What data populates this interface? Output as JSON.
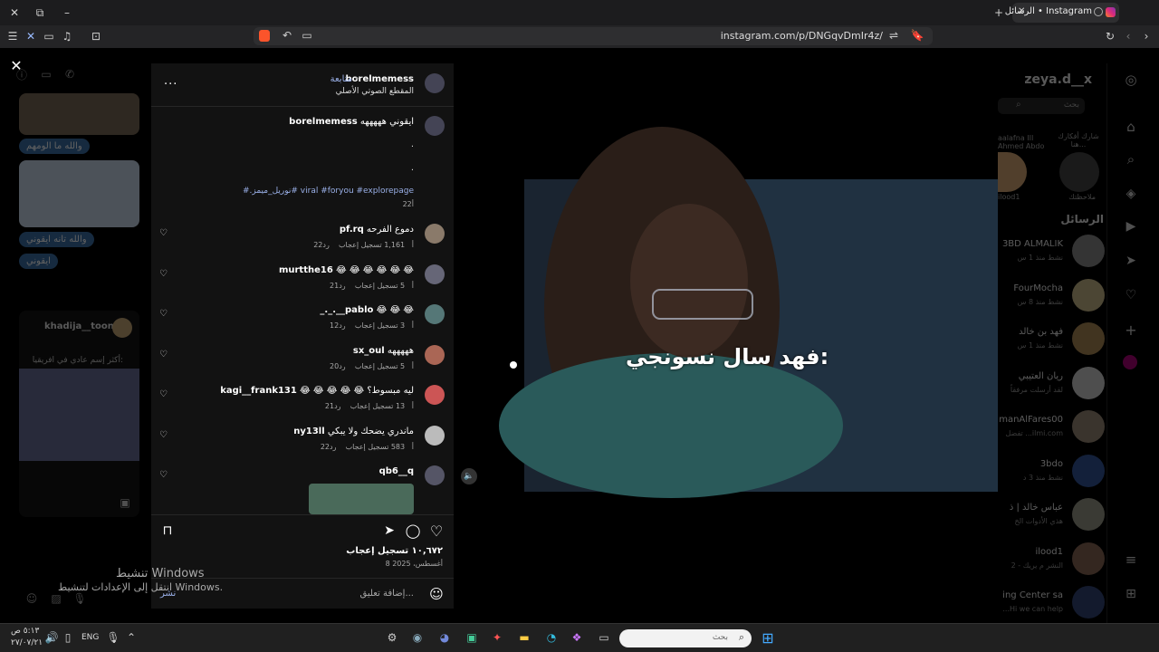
{
  "browser": {
    "tab_title": "الرسائل • Instagram",
    "tab_close": "✕",
    "new_tab": "+",
    "url": "instagram.com/p/DNGqvDmIr4z/",
    "window_controls": {
      "close": "✕",
      "restore": "⧉",
      "minimize": "–"
    }
  },
  "dm_bg": {
    "bubbles": [
      "والله ما الومهم",
      "والله تانه ايقوني",
      "ايقوني"
    ],
    "shared_user": "khadija__toon",
    "shared_caption": "أكثر إسم عادي في افريقيا:"
  },
  "post": {
    "author": "borelmemess",
    "follow": "متابعة",
    "dot": "•",
    "audio": "المقطع الصوتي الأصلي",
    "caption_user": "borelmemess",
    "caption_text": "ايقوني هههههه",
    "caption_dot1": ".",
    "caption_dot2": ".",
    "hashtags": "#.نوريل_ميمز# viral #foryou #explorepage",
    "caption_age": "22أ",
    "likes": "١٠,٦٧٢ تسجيل إعجاب",
    "date": "8 أغسطس، 2025",
    "comment_placeholder": "إضافة تعليق...",
    "post_btn": "نشر",
    "more": "...",
    "video_subtitle": "فهد سال نسونجي:",
    "mute": "🔈"
  },
  "comments": [
    {
      "user": "pf.rq",
      "text": "دموع الفرحه",
      "age": "22أ",
      "likes": "1,161 تسجيل إعجاب",
      "reply": "رد"
    },
    {
      "user": "murtthe16",
      "text": "😂 😂 😂 😂 😂 😂",
      "age": "21أ",
      "likes": "5 تسجيل إعجاب",
      "reply": "رد"
    },
    {
      "user": "_._.__pablo",
      "text": "😂 😂 😂",
      "age": "12أ",
      "likes": "3 تسجيل إعجاب",
      "reply": "رد"
    },
    {
      "user": "sx_oul",
      "text": "هههههه",
      "age": "20أ",
      "likes": "5 تسجيل إعجاب",
      "reply": "رد"
    },
    {
      "user": "kagi__frank131",
      "text": "😂 😂 😂 😂 😂 ليه مبسوط؟",
      "age": "21أ",
      "likes": "13 تسجيل إعجاب",
      "reply": "رد"
    },
    {
      "user": "ny13ll",
      "text": "ماندري يضحك ولا يبكي",
      "age": "22أ",
      "likes": "583 تسجيل إعجاب",
      "reply": "رد"
    },
    {
      "user": "qb6__q",
      "text": "",
      "age": "",
      "likes": "",
      "reply": ""
    }
  ],
  "right_panel": {
    "account": "zeya.d__x",
    "search": "بحث",
    "notes_caption": "شارك أفكارك هنا...",
    "note_user1": "ملاحظتك",
    "note_user2": "ilood1",
    "note_user3_a": "aalafna III",
    "note_user3_b": "Ahmed Abdo",
    "section": "الرسائل",
    "threads": [
      {
        "name": "3BD ALMALIK",
        "sub": "نشط منذ 1 س"
      },
      {
        "name": "FourMocha",
        "sub": "نشط منذ 8 س"
      },
      {
        "name": "فهد بن خالد",
        "sub": "نشط منذ 1 س"
      },
      {
        "name": "ريان العتيبي",
        "sub": "لقد أرسلت مرفقاً"
      },
      {
        "name": "manAlFares00",
        "sub": "تفضل ...ilmi.com"
      },
      {
        "name": "3bdo",
        "sub": "نشط منذ 3 د"
      },
      {
        "name": "عباس خالد | ذ",
        "sub": "هذي الأدوات الخ"
      },
      {
        "name": "ilood1",
        "sub": "النشر م يريك - 2"
      },
      {
        "name": "ing Center sa",
        "sub": "...Hi we can help"
      }
    ]
  },
  "windows_watermark": {
    "line1": "تنشيط Windows",
    "line2": "انتقل إلى الإعدادات لتنشيط Windows."
  },
  "taskbar": {
    "search": "بحث",
    "lang": "ENG",
    "time": "٥:١٣ ص",
    "date": "٢٧/٠٧/٢١"
  },
  "colors": {
    "accent": "#0095f6",
    "link": "#9ab0e8",
    "bubble": "#3a6ea5",
    "tabbar": "#1c1c1e"
  }
}
